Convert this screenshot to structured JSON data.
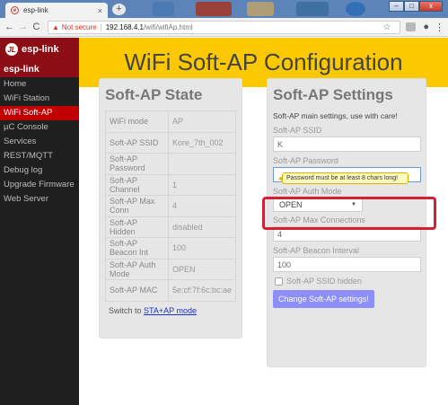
{
  "browser": {
    "tab_title": "esp-link",
    "tab_close": "×",
    "new_tab": "+",
    "not_secure": "Not secure",
    "url_host": "192.168.4.1",
    "url_path": "/wifi/wifiAp.html",
    "window_controls": [
      "–",
      "□",
      "x"
    ]
  },
  "sidebar": {
    "logo_text": "esp-link",
    "heading": "esp-link",
    "items": [
      {
        "label": "Home"
      },
      {
        "label": "WiFi Station"
      },
      {
        "label": "WiFi Soft-AP"
      },
      {
        "label": "µC Console"
      },
      {
        "label": "Services"
      },
      {
        "label": "REST/MQTT"
      },
      {
        "label": "Debug log"
      },
      {
        "label": "Upgrade Firmware"
      },
      {
        "label": "Web Server"
      }
    ]
  },
  "header": {
    "title": "WiFi Soft-AP Configuration"
  },
  "state": {
    "title": "Soft-AP State",
    "rows": [
      {
        "key": "WiFi mode",
        "value": "AP"
      },
      {
        "key": "Soft-AP SSID",
        "value": "Kore_7th_002"
      },
      {
        "key": "Soft-AP Password",
        "value": ""
      },
      {
        "key": "Soft-AP Channel",
        "value": "1"
      },
      {
        "key": "Soft-AP Max Conn",
        "value": "4"
      },
      {
        "key": "Soft-AP Hidden",
        "value": "disabled"
      },
      {
        "key": "Soft-AP Beacon Int",
        "value": "100"
      },
      {
        "key": "Soft-AP Auth Mode",
        "value": "OPEN"
      },
      {
        "key": "Soft-AP MAC",
        "value": "5e:cf:7f:6c:bc:ae"
      }
    ],
    "switch_prefix": "Switch to ",
    "switch_link": "STA+AP mode"
  },
  "settings": {
    "title": "Soft-AP Settings",
    "intro": "Soft-AP main settings, use with care!",
    "ssid_label": "Soft-AP SSID",
    "ssid_value": "K",
    "password_label": "Soft-AP Password",
    "password_value": "",
    "auth_label": "Soft-AP Auth Mode",
    "auth_value": "OPEN",
    "maxconn_label": "Soft-AP Max Connections",
    "maxconn_value": "4",
    "beacon_label": "Soft-AP Beacon Interval",
    "beacon_value": "100",
    "hidden_label": "Soft-AP SSID hidden",
    "hidden_checked": false,
    "submit_label": "Change Soft-AP settings!"
  },
  "tooltip": {
    "text": "Password must be at least 8 chars long!"
  },
  "colors": {
    "header_bg": "#fcc900",
    "sidebar_bg": "#1f1f1f",
    "active_nav": "#c00000",
    "button_bg": "#8e8ef8",
    "highlight": "#d41f35"
  }
}
